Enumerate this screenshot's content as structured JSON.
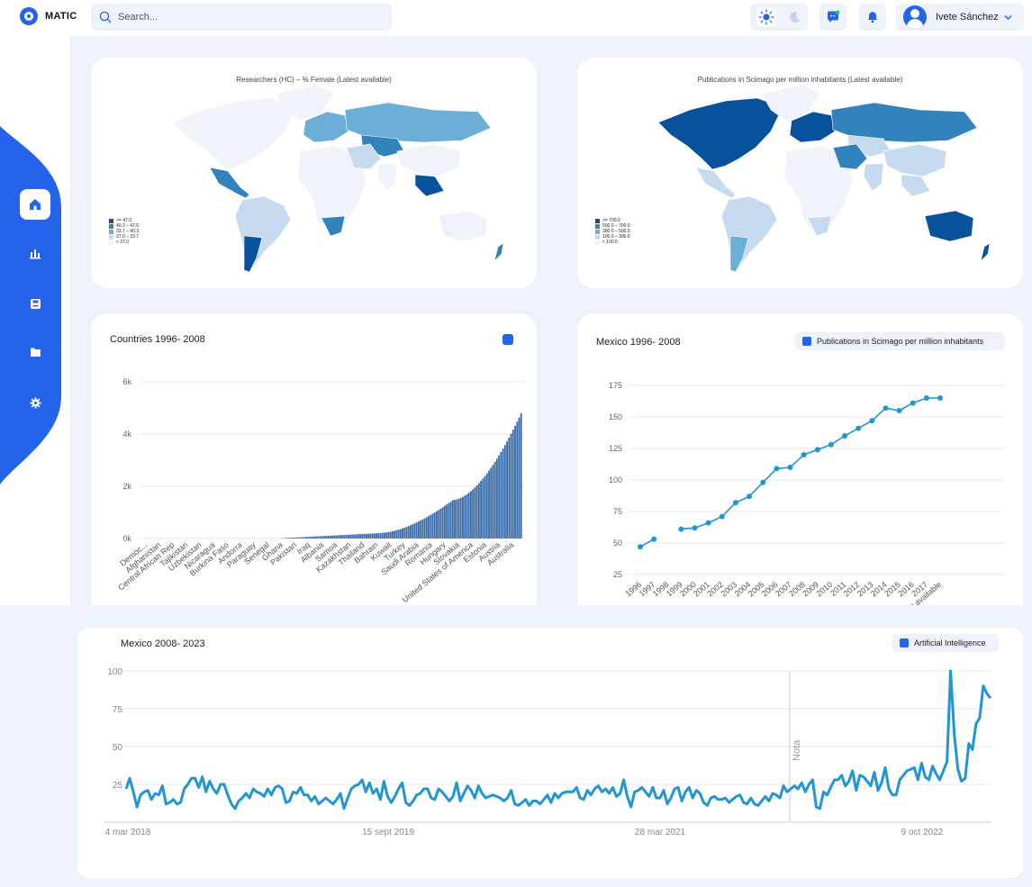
{
  "app": {
    "name": "MATIC"
  },
  "search": {
    "placeholder": "Search..."
  },
  "user": {
    "name": "Ivete Sánchez"
  },
  "colors": {
    "accent": "#2563eb",
    "line": "#2196d3",
    "bar": "#3b6ea8",
    "map": [
      "#f0f3fa",
      "#c6dbef",
      "#6baed6",
      "#3182bd",
      "#08519c"
    ]
  },
  "map_female": {
    "title": "Researchers (HC) – % Female (Latest available)",
    "legend": [
      ">= 47.0",
      "40.3 – 47.0",
      "33.7 – 40.3",
      "27.0 – 33.7",
      "< 27.0"
    ]
  },
  "map_pubs": {
    "title": "Publications in Scimago per million inhabitants (Latest available)",
    "legend": [
      ">= 700.0",
      "500.0 – 700.0",
      "300.0 – 500.0",
      "100.0 – 300.0",
      "< 100.0"
    ]
  },
  "countries_chart": {
    "title": "Countries 1996- 2008",
    "chart_data": {
      "type": "bar",
      "title": "Countries 1996- 2008",
      "ylim": [
        0,
        6000
      ],
      "yticks": [
        "0k",
        "2k",
        "4k",
        "6k"
      ],
      "xtick_labels": [
        "Democ...",
        "Afghanistan",
        "Central African Rep",
        "Tajikistan",
        "Uzbekistan",
        "Nicaragua",
        "Burkina Faso",
        "Andorra",
        "Paraguay",
        "Senegal",
        "Ghana",
        "Pakistan",
        "Iraq",
        "Albania",
        "Samoa",
        "Kazakhstan",
        "Thailand",
        "Bahrain",
        "Kuwait",
        "Turkey",
        "Saudi Arabia",
        "Romania",
        "Hungary",
        "Slovakia",
        "United States of America",
        "Estonia",
        "Austria",
        "Australia"
      ],
      "note": "about 190 countries sorted ascending; values near 0 for first ~70, rising to about 4800 for the last"
    }
  },
  "mexico_chart": {
    "title": "Mexico 1996- 2008",
    "legend": "Publications in Scimago per million inhabitants",
    "yticks": [
      "25",
      "50",
      "75",
      "100",
      "125",
      "150",
      "175"
    ],
    "chart_data": {
      "type": "line",
      "title": "Mexico 1996- 2008",
      "ylim": [
        25,
        175
      ],
      "x": [
        "1996",
        "1997",
        "1998",
        "1999",
        "2000",
        "2001",
        "2002",
        "2003",
        "2004",
        "2005",
        "2006",
        "2007",
        "2008",
        "2009",
        "2010",
        "2011",
        "2012",
        "2013",
        "2014",
        "2015",
        "2016",
        "2017",
        "Latest available"
      ],
      "values": [
        47,
        53,
        null,
        61,
        62,
        66,
        71,
        82,
        87,
        98,
        109,
        110,
        120,
        124,
        128,
        135,
        141,
        147,
        157,
        155,
        161,
        165,
        165
      ]
    }
  },
  "ai_chart": {
    "title": "Mexico  2008- 2023",
    "legend": "Artificial Intelligence",
    "note_label": "Nota",
    "yticks": [
      "25",
      "50",
      "75",
      "100"
    ],
    "xticks": [
      "4 mar 2018",
      "15 sept 2019",
      "28 mar 2021",
      "9 oct 2022"
    ],
    "chart_data": {
      "type": "line",
      "title": "Mexico  2008- 2023",
      "ylim": [
        0,
        100
      ],
      "series": [
        {
          "name": "Artificial Intelligence",
          "values": [
            22,
            29,
            20,
            10,
            18,
            20,
            21,
            15,
            19,
            18,
            24,
            12,
            13,
            15,
            12,
            13,
            22,
            25,
            29,
            29,
            23,
            30,
            20,
            27,
            22,
            19,
            25,
            25,
            18,
            12,
            9,
            14,
            16,
            19,
            16,
            22,
            20,
            19,
            17,
            22,
            18,
            23,
            24,
            22,
            13,
            14,
            20,
            19,
            23,
            18,
            18,
            14,
            17,
            12,
            14,
            16,
            14,
            12,
            15,
            19,
            9,
            16,
            22,
            24,
            25,
            28,
            20,
            26,
            19,
            22,
            15,
            27,
            17,
            13,
            17,
            22,
            26,
            13,
            11,
            14,
            18,
            19,
            22,
            22,
            16,
            15,
            22,
            20,
            17,
            14,
            17,
            26,
            14,
            19,
            24,
            21,
            16,
            24,
            19,
            16,
            17,
            18,
            17,
            16,
            14,
            16,
            21,
            12,
            11,
            13,
            15,
            11,
            14,
            14,
            12,
            15,
            18,
            13,
            19,
            16,
            19,
            20,
            20,
            20,
            23,
            16,
            15,
            21,
            18,
            22,
            24,
            20,
            22,
            19,
            23,
            17,
            19,
            28,
            17,
            10,
            20,
            21,
            23,
            20,
            17,
            23,
            16,
            16,
            21,
            12,
            16,
            22,
            23,
            14,
            20,
            23,
            16,
            21,
            19,
            13,
            11,
            16,
            17,
            15,
            15,
            16,
            13,
            15,
            17,
            18,
            13,
            12,
            16,
            12,
            11,
            14,
            17,
            14,
            19,
            18,
            16,
            24,
            20,
            22,
            24,
            22,
            26,
            20,
            25,
            28,
            10,
            9,
            20,
            18,
            23,
            28,
            28,
            31,
            24,
            27,
            34,
            21,
            31,
            30,
            27,
            24,
            33,
            21,
            26,
            36,
            22,
            18,
            18,
            28,
            31,
            34,
            35,
            36,
            28,
            39,
            30,
            28,
            37,
            32,
            28,
            34,
            40,
            100,
            58,
            35,
            27,
            29,
            52,
            48,
            65,
            69,
            90,
            85,
            82
          ]
        }
      ]
    }
  }
}
